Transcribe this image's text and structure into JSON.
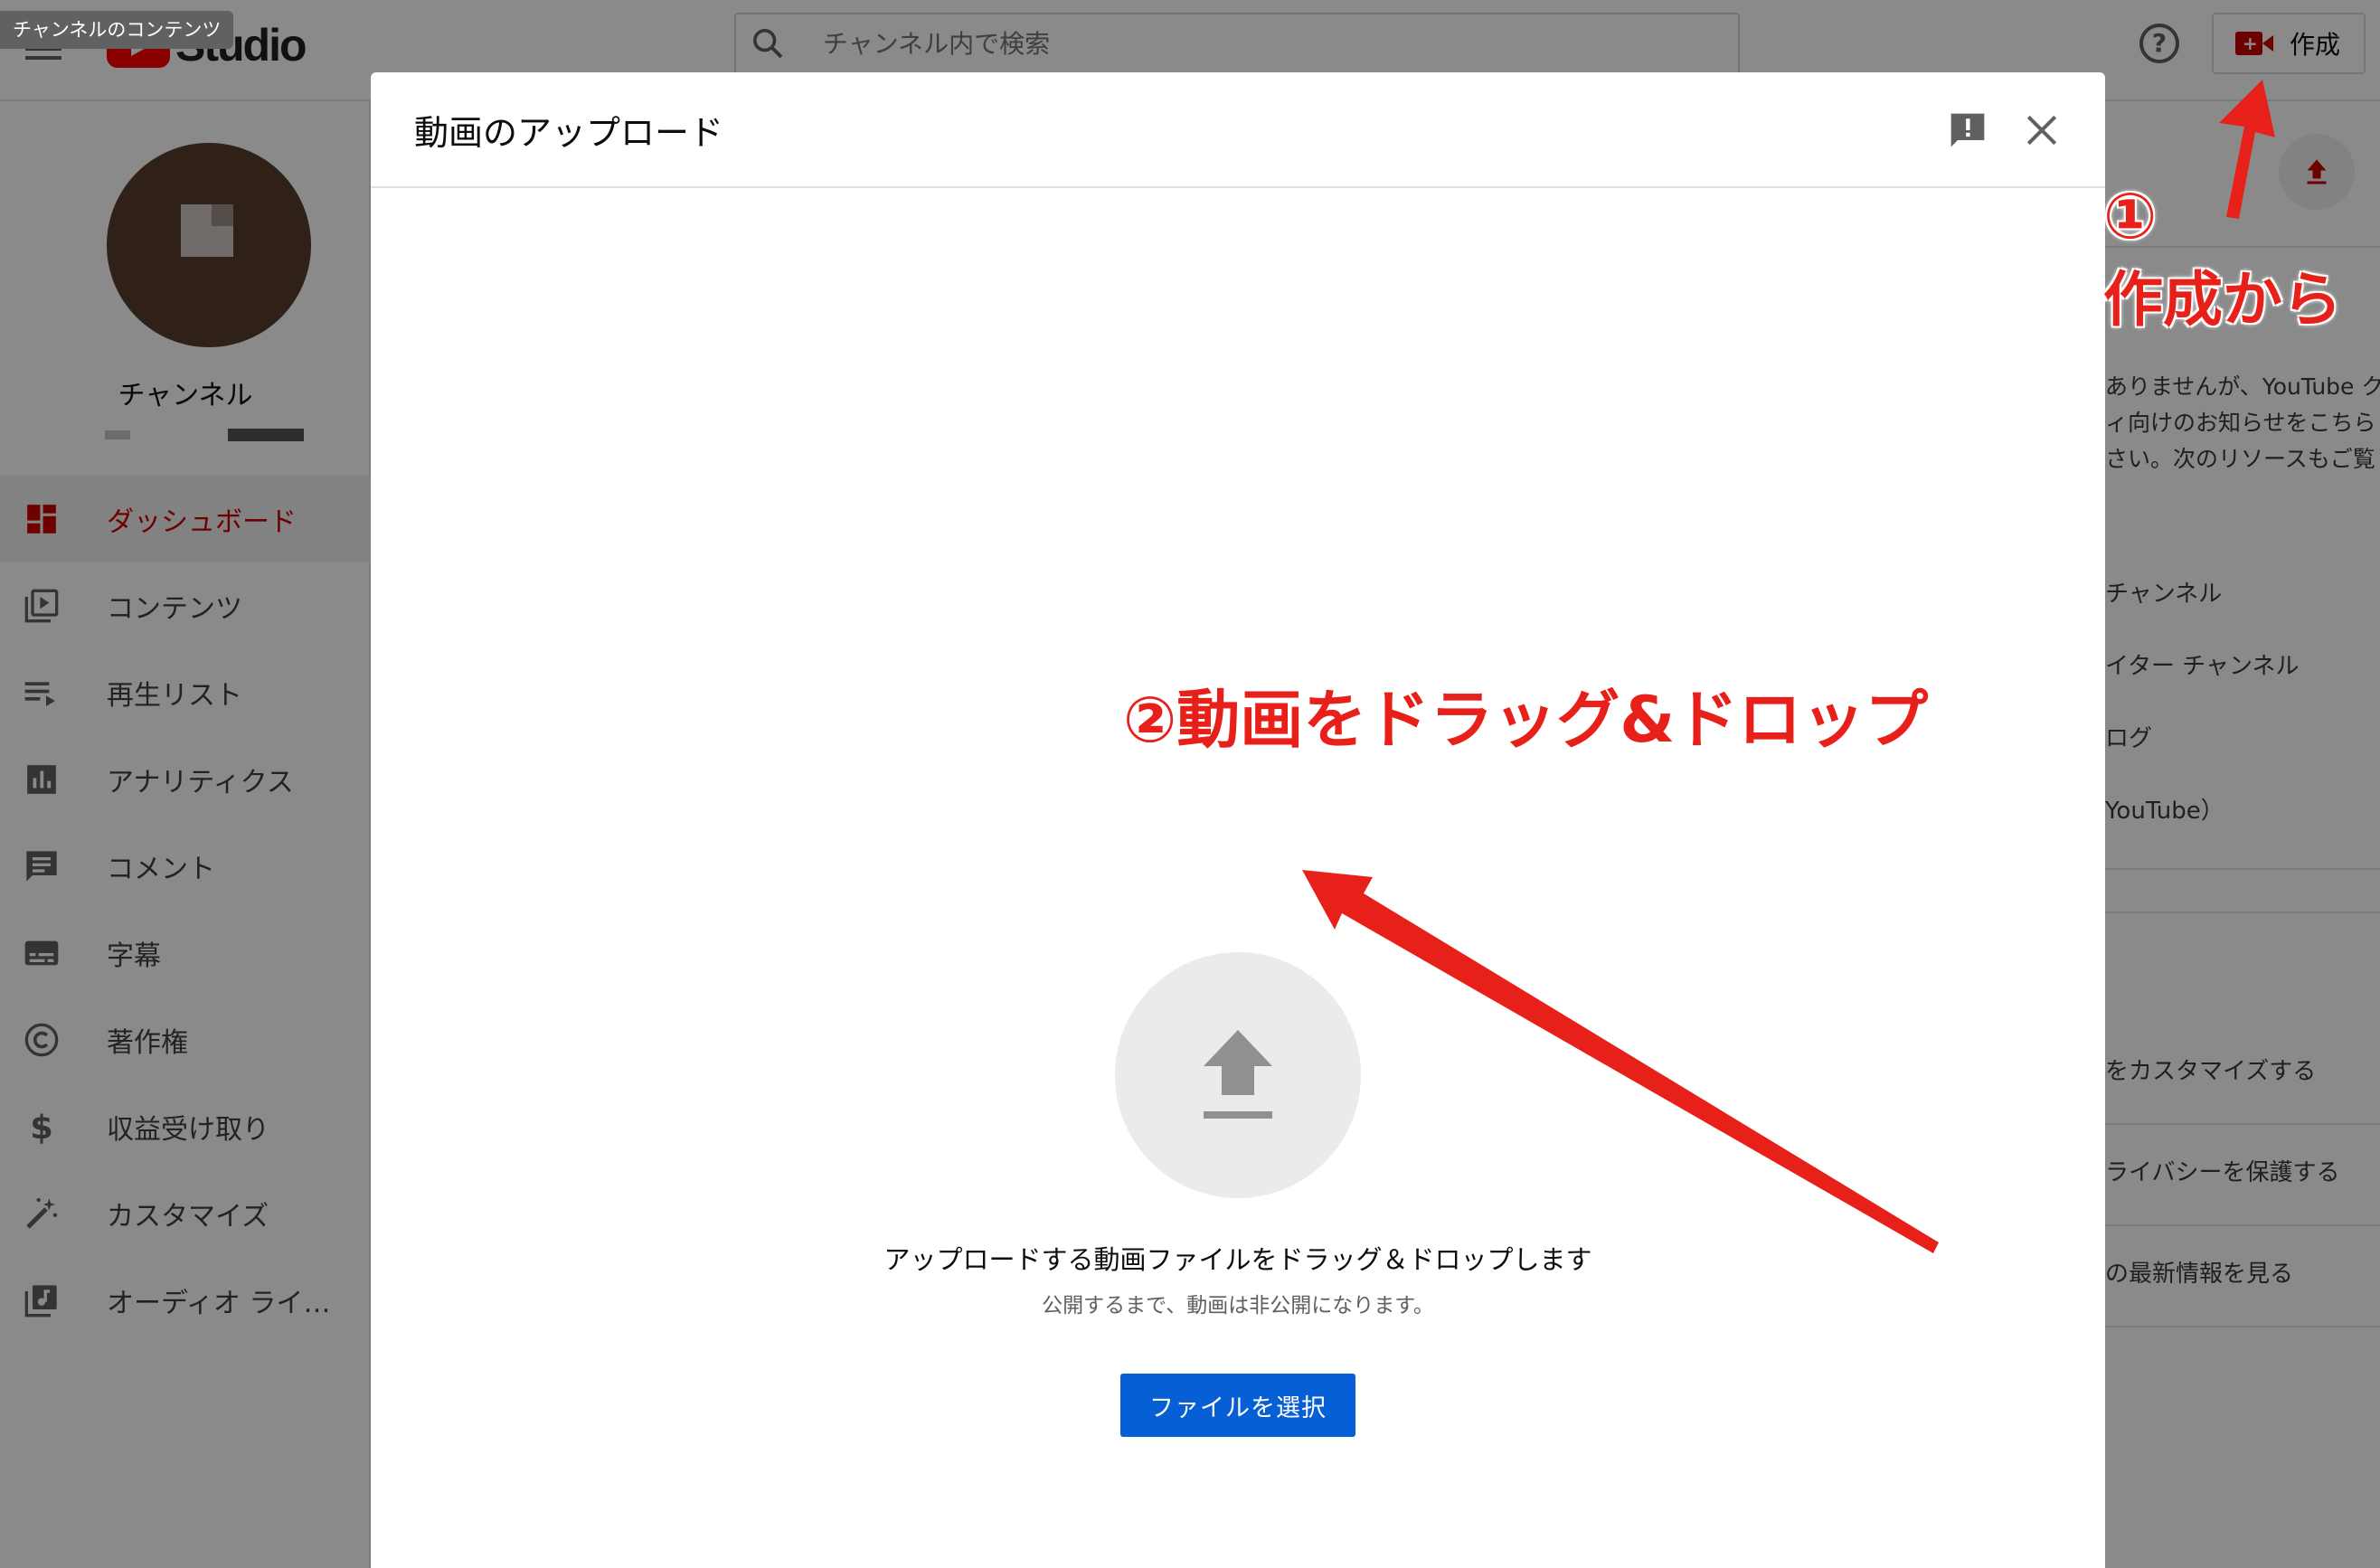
{
  "page_title_chip": "チャンネルのコンテンツ",
  "logo": {
    "text": "Studio"
  },
  "search": {
    "placeholder": "チャンネル内で検索"
  },
  "header": {
    "create_label": "作成"
  },
  "sidebar": {
    "channel_label": "チャンネル",
    "items": [
      {
        "label": "ダッシュボード",
        "icon": "dashboard-icon",
        "active": true
      },
      {
        "label": "コンテンツ",
        "icon": "video-library-icon",
        "active": false
      },
      {
        "label": "再生リスト",
        "icon": "playlist-icon",
        "active": false
      },
      {
        "label": "アナリティクス",
        "icon": "analytics-icon",
        "active": false
      },
      {
        "label": "コメント",
        "icon": "comment-icon",
        "active": false
      },
      {
        "label": "字幕",
        "icon": "subtitles-icon",
        "active": false
      },
      {
        "label": "著作権",
        "icon": "copyright-icon",
        "active": false
      },
      {
        "label": "収益受け取り",
        "icon": "dollar-icon",
        "active": false
      },
      {
        "label": "カスタマイズ",
        "icon": "magic-wand-icon",
        "active": false
      },
      {
        "label": "オーディオ ライブ…",
        "icon": "audio-library-icon",
        "active": false
      }
    ]
  },
  "right_panel": {
    "body_lines": [
      "ありませんが、YouTube ク",
      "ィ向けのお知らせをこちら",
      "さい。次のリソースもご覧"
    ],
    "links": [
      "チャンネル",
      "イター チャンネル",
      "ログ",
      "YouTube）"
    ],
    "bottom_links": [
      "をカスタマイズする",
      "ライバシーを保護する",
      "の最新情報を見る"
    ]
  },
  "dialog": {
    "title": "動画のアップロード",
    "drop_main": "アップロードする動画ファイルをドラッグ＆ドロップします",
    "drop_sub": "公開するまで、動画は非公開になります。",
    "select_button": "ファイルを選択"
  },
  "annotations": {
    "step1_number": "①",
    "step1_text": "作成から",
    "step2_text": "②動画をドラッグ&ドロップ"
  },
  "colors": {
    "accent_red": "#cc0000",
    "annotation_red": "#e8201a",
    "primary_blue": "#065fd4"
  }
}
